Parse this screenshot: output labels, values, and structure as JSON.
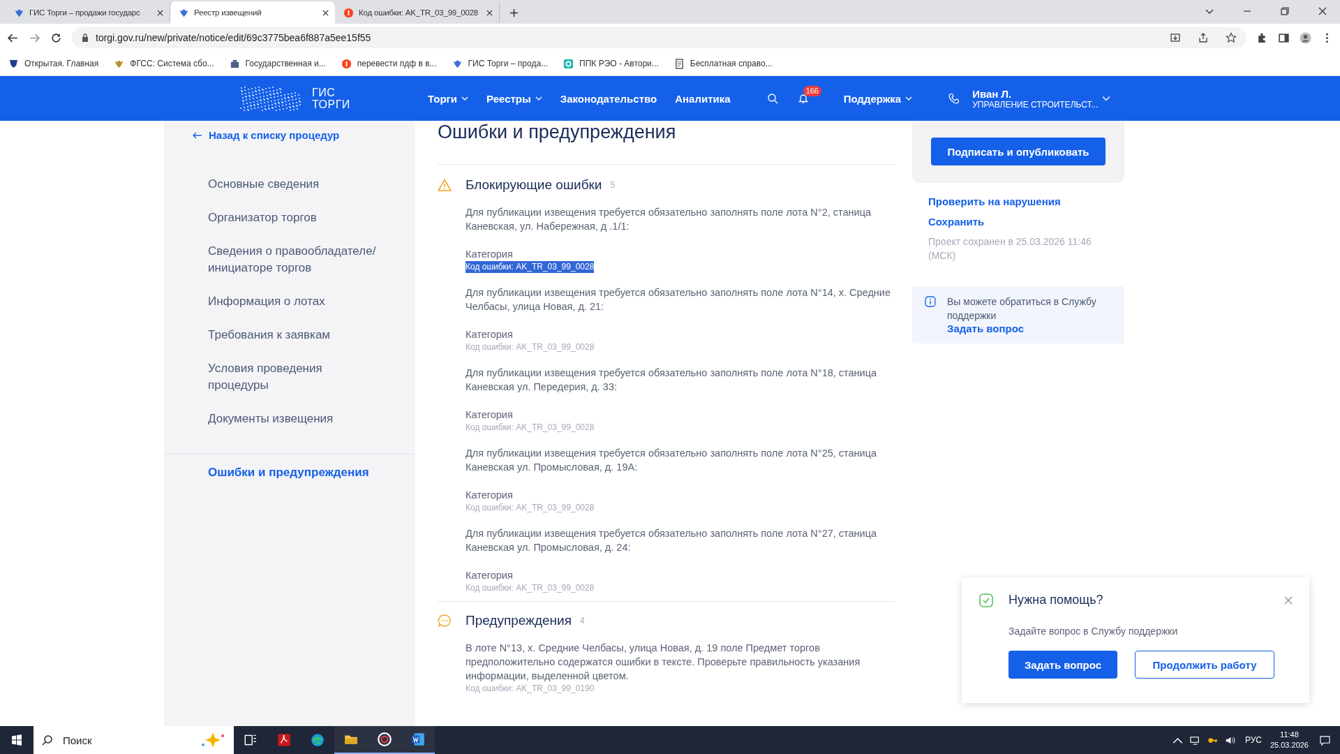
{
  "browser": {
    "tabs": [
      {
        "title": "ГИС Торги – продажи государс",
        "selected": false
      },
      {
        "title": "Реестр извещений",
        "selected": true
      },
      {
        "title": "Код ошибки: AK_TR_03_99_0028",
        "selected": false
      }
    ],
    "address": "torgi.gov.ru/new/private/notice/edit/69c3775bea6f887a5ee15f55",
    "bookmarks": [
      {
        "label": "Открытая. Главная"
      },
      {
        "label": "ФГСС: Система сбо..."
      },
      {
        "label": "Государственная и..."
      },
      {
        "label": "перевести пдф в в..."
      },
      {
        "label": "ГИС Торги – прода..."
      },
      {
        "label": "ППК РЭО - Автори..."
      },
      {
        "label": "Бесплатная справо..."
      }
    ]
  },
  "header": {
    "logo_lines": [
      "ГИС",
      "ТОРГИ"
    ],
    "nav": [
      {
        "label": "Торги",
        "dropdown": true
      },
      {
        "label": "Реестры",
        "dropdown": true
      },
      {
        "label": "Законодательство",
        "dropdown": false
      },
      {
        "label": "Аналитика",
        "dropdown": false
      }
    ],
    "notifications": "166",
    "support": "Поддержка",
    "user_name": "Иван Л.",
    "user_org": "УПРАВЛЕНИЕ СТРОИТЕЛЬСТ..."
  },
  "sidebar": {
    "back_link": "Назад к списку процедур",
    "items": [
      {
        "label": "Основные сведения",
        "selected": false
      },
      {
        "label": "Организатор торгов",
        "selected": false
      },
      {
        "label": "Сведения о правообладателе/ инициаторе торгов",
        "selected": false
      },
      {
        "label": "Информация о лотах",
        "selected": false
      },
      {
        "label": "Требования к заявкам",
        "selected": false
      },
      {
        "label": "Условия проведения процедуры",
        "selected": false
      },
      {
        "label": "Документы извещения",
        "selected": false
      }
    ],
    "active_item": {
      "label": "Ошибки и предупреждения",
      "selected": true
    }
  },
  "content": {
    "title": "Ошибки и предупреждения",
    "sections": [
      {
        "kind": "blocking",
        "title": "Блокирующие ошибки",
        "count": "5",
        "items": [
          {
            "text": "Для публикации извещения требуется обязательно заполнять поле лота N°2, станица Каневская, ул. Набережная, д .1/1:",
            "category": "Категория",
            "code": "Код ошибки: AK_TR_03_99_0028",
            "highlighted": true
          },
          {
            "text": "Для публикации извещения требуется обязательно заполнять поле лота N°14, х. Средние Челбасы, улица Новая, д. 21:",
            "category": "Категория",
            "code": "Код ошибки: AK_TR_03_99_0028",
            "highlighted": false
          },
          {
            "text": "Для публикации извещения требуется обязательно заполнять поле лота N°18, станица Каневская ул. Передерия, д. 33:",
            "category": "Категория",
            "code": "Код ошибки: AK_TR_03_99_0028",
            "highlighted": false
          },
          {
            "text": "Для публикации извещения требуется обязательно заполнять поле лота N°25, станица Каневская ул. Промысловая, д. 19А:",
            "category": "Категория",
            "code": "Код ошибки: AK_TR_03_99_0028",
            "highlighted": false
          },
          {
            "text": "Для публикации извещения требуется обязательно заполнять поле лота N°27, станица Каневская ул. Промысловая, д. 24:",
            "category": "Категория",
            "code": "Код ошибки: AK_TR_03_99_0028",
            "highlighted": false
          }
        ]
      },
      {
        "kind": "warning",
        "title": "Предупреждения",
        "count": "4",
        "items": [
          {
            "text": "В лоте N°13, х. Средние Челбасы, улица Новая, д. 19 поле Предмет торгов предположительно содержатся ошибки в тексте. Проверьте правильность указания информации, выделенной цветом.",
            "code": "Код ошибки: AK_TR_03_99_0190",
            "highlighted": false
          }
        ]
      }
    ]
  },
  "right_panel": {
    "primary_button": "Подписать и опубликовать",
    "links": [
      "Проверить на нарушения",
      "Сохранить"
    ],
    "saved_note": "Проект сохранен в 25.03.2026 11:46 (МСК)",
    "info_text": "Вы можете обратиться в Службу поддержки",
    "info_link": "Задать вопрос"
  },
  "popup": {
    "title": "Нужна помощь?",
    "text": "Задайте вопрос в Службу поддержки",
    "buttons": [
      {
        "label": "Задать вопрос",
        "kind": "primary"
      },
      {
        "label": "Продолжить работу",
        "kind": "secondary"
      }
    ]
  },
  "taskbar": {
    "search": "Поиск",
    "apps": [
      {
        "kind": "taskview",
        "active": false
      },
      {
        "kind": "pdf",
        "active": false
      },
      {
        "kind": "edge",
        "active": false
      },
      {
        "kind": "folder",
        "active": true
      },
      {
        "kind": "ring",
        "active": true
      },
      {
        "kind": "word",
        "active": true
      }
    ],
    "language": "РУС",
    "time": "11:48",
    "date": "25.03.2026"
  }
}
